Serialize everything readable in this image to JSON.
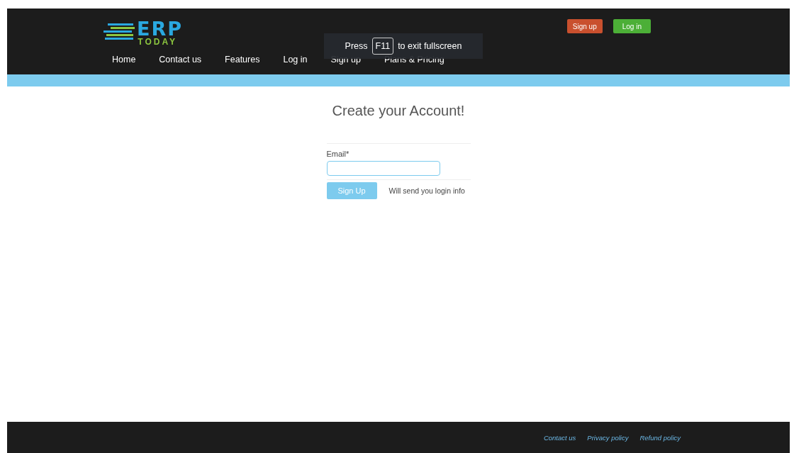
{
  "logo": {
    "word": "ERP",
    "subword": "TODAY"
  },
  "nav": [
    {
      "label": "Home"
    },
    {
      "label": "Contact us"
    },
    {
      "label": "Features"
    },
    {
      "label": "Log in"
    },
    {
      "label": "Sign up"
    },
    {
      "label": "Plans & Pricing"
    }
  ],
  "header_buttons": [
    {
      "label": "Sign up",
      "kind": "signup"
    },
    {
      "label": "Log in",
      "kind": "login"
    }
  ],
  "fullscreen_notice": {
    "before": "Press",
    "key": "F11",
    "after": "to exit fullscreen"
  },
  "form": {
    "title": "Create your Account!",
    "email_label": "Email*",
    "submit": "Sign Up",
    "note": "Will send you login info"
  },
  "footer_links": [
    "Contact us",
    "Privacy policy",
    "Refund policy"
  ]
}
